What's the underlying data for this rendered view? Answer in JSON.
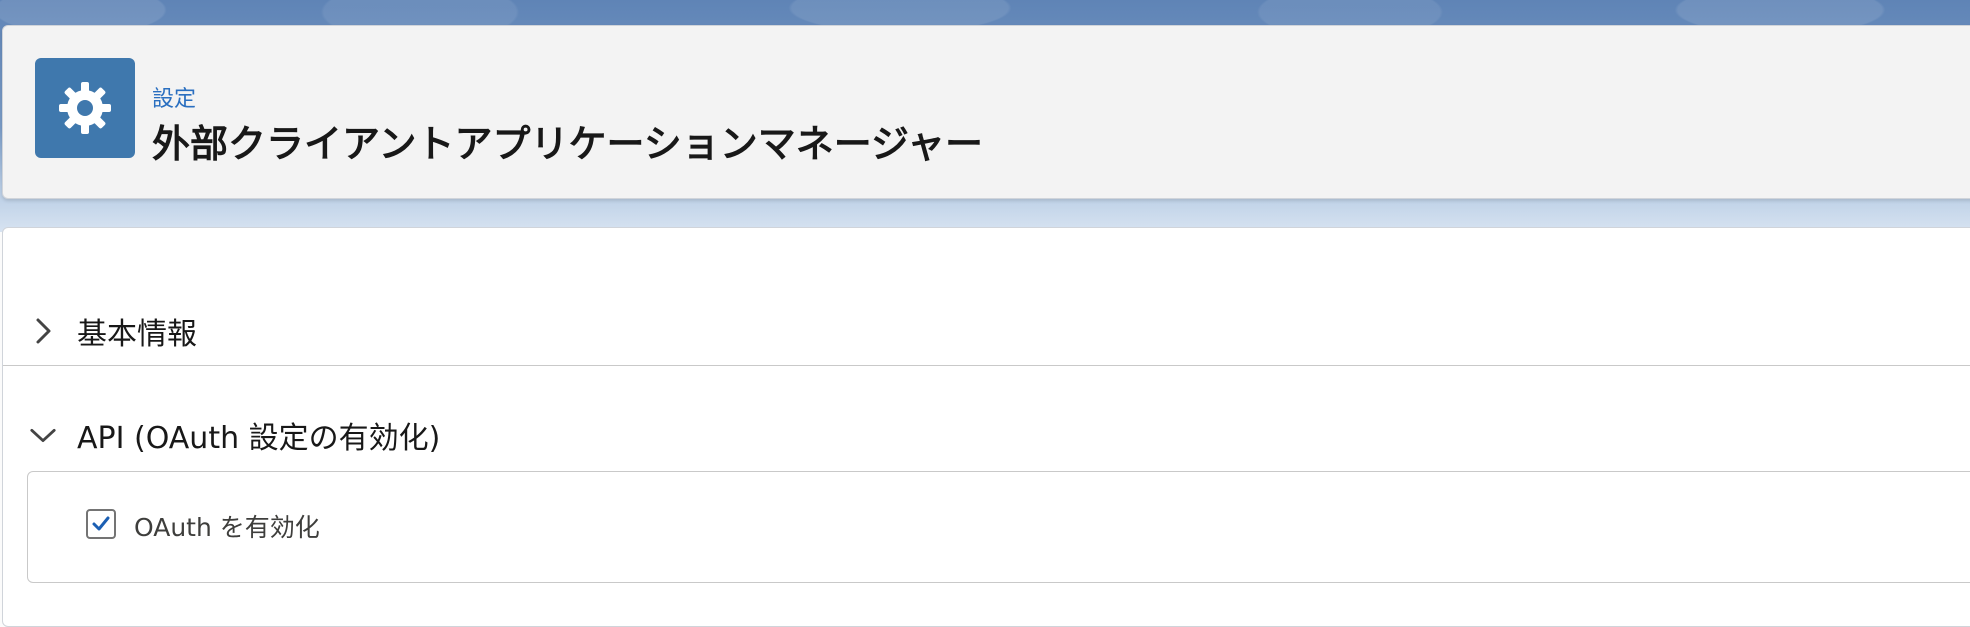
{
  "header": {
    "icon": "gear-icon",
    "eyebrow": "設定",
    "title": "外部クライアントアプリケーションマネージャー"
  },
  "sections": [
    {
      "label": "基本情報",
      "expanded": false,
      "chevron_icon": "chevron-right-icon"
    },
    {
      "label": "API (OAuth 設定の有効化)",
      "expanded": true,
      "chevron_icon": "chevron-down-icon"
    }
  ],
  "oauth": {
    "checkbox_label": "OAuth を有効化",
    "checked": true
  },
  "colors": {
    "header_icon_bg": "#3f78ad",
    "eyebrow_link": "#2a6fc0",
    "checkmark": "#1b5fb3"
  }
}
